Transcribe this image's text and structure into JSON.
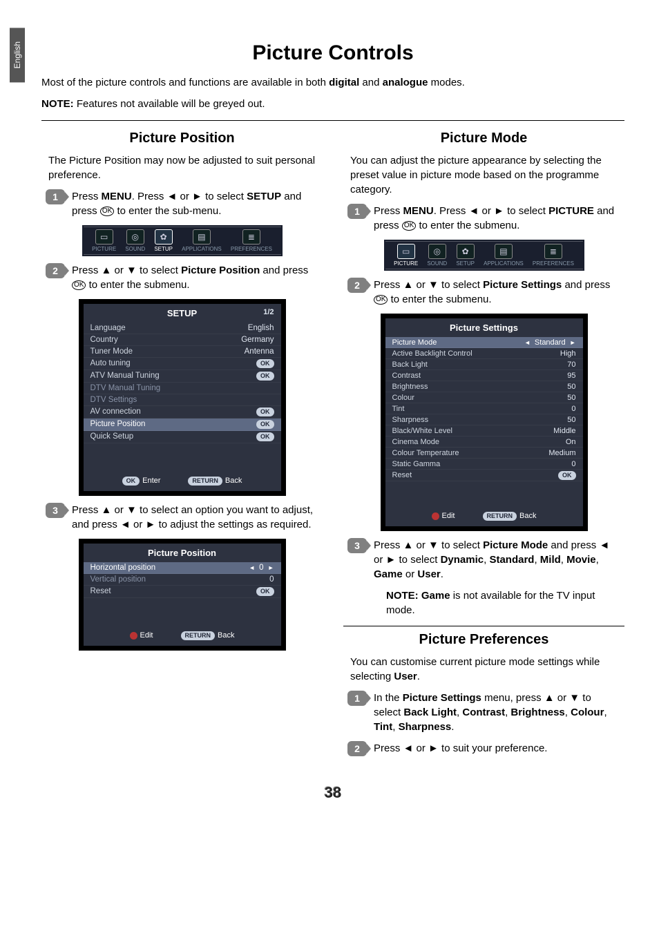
{
  "language_tab": "English",
  "page_number": "38",
  "title": "Picture Controls",
  "intro_line1_pre": "Most of the picture controls and functions are available in both ",
  "intro_line1_b1": "digital",
  "intro_line1_mid": " and ",
  "intro_line1_b2": "analogue",
  "intro_line1_post": " modes.",
  "intro_note_label": "NOTE:",
  "intro_note_text": " Features not available will be greyed out.",
  "left": {
    "heading": "Picture Position",
    "desc": "The Picture Position may now be adjusted to suit personal preference.",
    "step1": {
      "num": "1",
      "t1": "Press ",
      "b1": "MENU",
      "t2": ". Press ◄ or ► to select ",
      "b2": "SETUP",
      "t3": " and press ",
      "ok": "OK",
      "t4": " to enter the sub-menu."
    },
    "menubar": {
      "items": [
        {
          "label": "PICTURE",
          "icon": "▭"
        },
        {
          "label": "SOUND",
          "icon": "◎"
        },
        {
          "label": "SETUP",
          "icon": "✿",
          "selected": true
        },
        {
          "label": "APPLICATIONS",
          "icon": "▤"
        },
        {
          "label": "PREFERENCES",
          "icon": "≣"
        }
      ]
    },
    "step2": {
      "num": "2",
      "t1": "Press ▲ or ▼ to select ",
      "b1": "Picture Position",
      "t2": " and press ",
      "ok": "OK",
      "t3": " to enter the submenu."
    },
    "setup_panel": {
      "title": "SETUP",
      "page": "1/2",
      "rows": [
        {
          "label": "Language",
          "value": "English"
        },
        {
          "label": "Country",
          "value": "Germany"
        },
        {
          "label": "Tuner Mode",
          "value": "Antenna"
        },
        {
          "label": "Auto tuning",
          "value": "OK",
          "pill": true
        },
        {
          "label": "ATV Manual Tuning",
          "value": "OK",
          "pill": true
        },
        {
          "label": "DTV Manual Tuning",
          "value": "",
          "dim": true
        },
        {
          "label": "DTV Settings",
          "value": "",
          "dim": true
        },
        {
          "label": "AV connection",
          "value": "OK",
          "pill": true
        },
        {
          "label": "Picture Position",
          "value": "OK",
          "pill": true,
          "hl": true
        },
        {
          "label": "Quick Setup",
          "value": "OK",
          "pill": true
        }
      ],
      "foot_enter_pill": "OK",
      "foot_enter": "Enter",
      "foot_back_pill": "RETURN",
      "foot_back": "Back"
    },
    "step3": {
      "num": "3",
      "text": "Press ▲ or ▼ to select an option you want to adjust, and press ◄ or ► to adjust the settings as required."
    },
    "pos_panel": {
      "title": "Picture Position",
      "rows": [
        {
          "label": "Horizontal position",
          "value": "0",
          "hl": true,
          "arrows": true
        },
        {
          "label": "Vertical position",
          "value": "0",
          "dim": true
        },
        {
          "label": "Reset",
          "value": "OK",
          "pill": true
        }
      ],
      "foot_edit": "Edit",
      "foot_back_pill": "RETURN",
      "foot_back": "Back"
    }
  },
  "right": {
    "heading": "Picture Mode",
    "desc": "You can adjust the picture appearance by selecting the preset value in picture mode based on the programme category.",
    "step1": {
      "num": "1",
      "t1": "Press ",
      "b1": "MENU",
      "t2": ". Press ◄ or ► to select ",
      "b2": "PICTURE",
      "t3": " and press ",
      "ok": "OK",
      "t4": " to enter the submenu."
    },
    "menubar": {
      "items": [
        {
          "label": "PICTURE",
          "icon": "▭",
          "selected": true
        },
        {
          "label": "SOUND",
          "icon": "◎"
        },
        {
          "label": "SETUP",
          "icon": "✿"
        },
        {
          "label": "APPLICATIONS",
          "icon": "▤"
        },
        {
          "label": "PREFERENCES",
          "icon": "≣"
        }
      ]
    },
    "step2": {
      "num": "2",
      "t1": "Press ▲ or ▼ to select ",
      "b1": "Picture Settings",
      "t2": " and press ",
      "ok": "OK",
      "t3": " to enter the submenu."
    },
    "picset_panel": {
      "title": "Picture Settings",
      "rows": [
        {
          "label": "Picture Mode",
          "value": "Standard",
          "hl": true,
          "arrows": true
        },
        {
          "label": "Active Backlight Control",
          "value": "High"
        },
        {
          "label": "Back Light",
          "value": "70"
        },
        {
          "label": "Contrast",
          "value": "95"
        },
        {
          "label": "Brightness",
          "value": "50"
        },
        {
          "label": "Colour",
          "value": "50"
        },
        {
          "label": "Tint",
          "value": "0"
        },
        {
          "label": "Sharpness",
          "value": "50"
        },
        {
          "label": "Black/White Level",
          "value": "Middle"
        },
        {
          "label": "Cinema Mode",
          "value": "On"
        },
        {
          "label": "Colour Temperature",
          "value": "Medium"
        },
        {
          "label": "Static Gamma",
          "value": "0"
        },
        {
          "label": "Reset",
          "value": "OK",
          "pill": true
        }
      ],
      "foot_edit": "Edit",
      "foot_back_pill": "RETURN",
      "foot_back": "Back"
    },
    "step3": {
      "num": "3",
      "t1": "Press ▲ or ▼ to select ",
      "b1": "Picture Mode",
      "t2": " and press ◄ or ► to select ",
      "b2": "Dynamic",
      "t3": ", ",
      "b3": "Standard",
      "t4": ", ",
      "b4": "Mild",
      "t5": ", ",
      "b5": "Movie",
      "t6": ", ",
      "b6": "Game",
      "t7": " or ",
      "b7": "User",
      "t8": "."
    },
    "note_label": "NOTE: ",
    "note_b": "Game",
    "note_text": " is not available for the TV input mode.",
    "pref_heading": "Picture Preferences",
    "pref_desc_t1": "You can customise current picture mode settings while selecting ",
    "pref_desc_b": "User",
    "pref_desc_t2": ".",
    "pref_step1": {
      "num": "1",
      "t1": "In the ",
      "b1": "Picture Settings",
      "t2": " menu, press ▲ or ▼ to select ",
      "b2": "Back Light",
      "t3": ", ",
      "b3": "Contrast",
      "t4": ", ",
      "b4": "Brightness",
      "t5": ", ",
      "b5": "Colour",
      "t6": ", ",
      "b6": "Tint",
      "t7": ", ",
      "b7": "Sharpness",
      "t8": "."
    },
    "pref_step2": {
      "num": "2",
      "text": "Press ◄ or ► to suit your preference."
    }
  }
}
